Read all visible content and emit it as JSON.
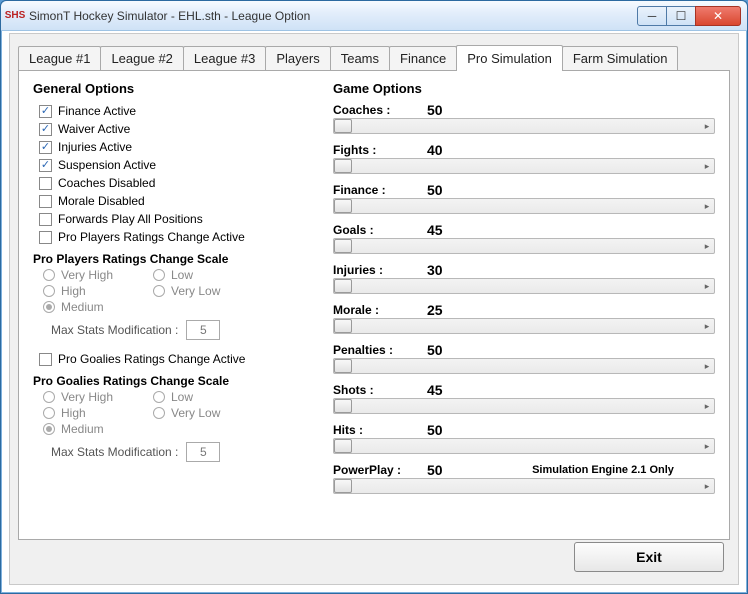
{
  "window": {
    "title": "SimonT Hockey Simulator - EHL.sth - League Option",
    "icon_text": "SHS"
  },
  "tabs": [
    {
      "label": "League #1"
    },
    {
      "label": "League #2"
    },
    {
      "label": "League #3"
    },
    {
      "label": "Players"
    },
    {
      "label": "Teams"
    },
    {
      "label": "Finance"
    },
    {
      "label": "Pro Simulation",
      "active": true
    },
    {
      "label": "Farm Simulation"
    }
  ],
  "general": {
    "heading": "General Options",
    "checkboxes": [
      {
        "label": "Finance Active",
        "checked": true
      },
      {
        "label": "Waiver Active",
        "checked": true
      },
      {
        "label": "Injuries Active",
        "checked": true
      },
      {
        "label": "Suspension Active",
        "checked": true
      },
      {
        "label": "Coaches Disabled",
        "checked": false
      },
      {
        "label": "Morale Disabled",
        "checked": false
      },
      {
        "label": "Forwards Play All Positions",
        "checked": false
      },
      {
        "label": "Pro Players Ratings Change Active",
        "checked": false
      }
    ],
    "players_scale": {
      "heading": "Pro Players Ratings Change Scale",
      "options": [
        "Very High",
        "Low",
        "High",
        "Very Low",
        "Medium"
      ],
      "selected": "Medium",
      "max_label": "Max Stats Modification :",
      "max_value": "5"
    },
    "goalies_check": {
      "label": "Pro Goalies Ratings Change Active",
      "checked": false
    },
    "goalies_scale": {
      "heading": "Pro Goalies Ratings Change Scale",
      "options": [
        "Very High",
        "Low",
        "High",
        "Very Low",
        "Medium"
      ],
      "selected": "Medium",
      "max_label": "Max Stats Modification :",
      "max_value": "5"
    }
  },
  "game": {
    "heading": "Game Options",
    "rows": [
      {
        "label": "Coaches :",
        "value": 50
      },
      {
        "label": "Fights :",
        "value": 40
      },
      {
        "label": "Finance :",
        "value": 50
      },
      {
        "label": "Goals :",
        "value": 45
      },
      {
        "label": "Injuries :",
        "value": 30
      },
      {
        "label": "Morale :",
        "value": 25
      },
      {
        "label": "Penalties :",
        "value": 50
      },
      {
        "label": "Shots :",
        "value": 45
      },
      {
        "label": "Hits :",
        "value": 50
      },
      {
        "label": "PowerPlay :",
        "value": 50,
        "note": "Simulation Engine 2.1 Only"
      }
    ]
  },
  "exit_label": "Exit"
}
